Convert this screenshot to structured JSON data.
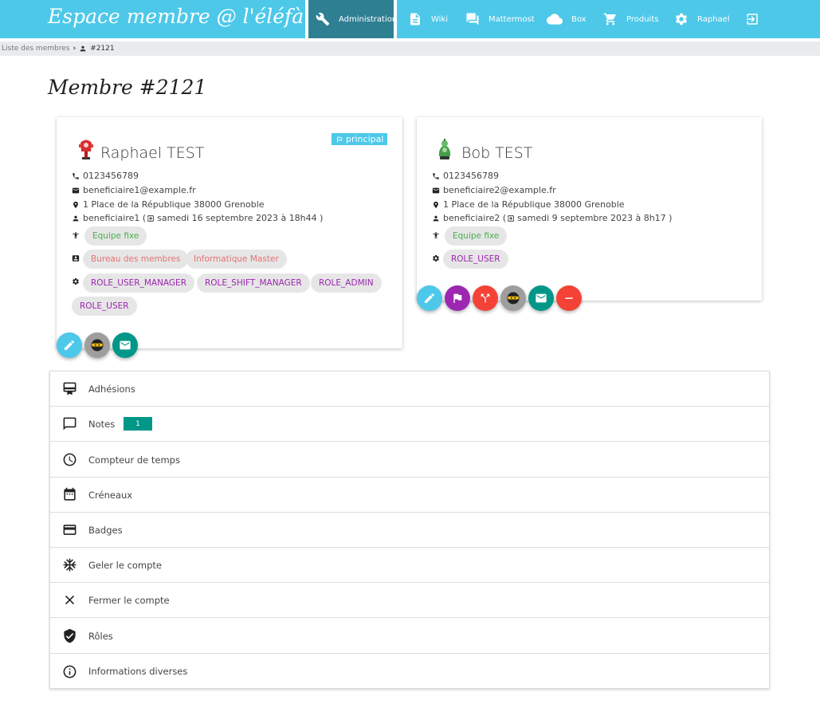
{
  "header": {
    "brand": "Espace membre @ l'éléfàn",
    "nav": [
      {
        "label": "Administration",
        "icon": "wrench-icon"
      },
      {
        "label": "Wiki",
        "icon": "document-icon"
      },
      {
        "label": "Mattermost",
        "icon": "chat-icon"
      },
      {
        "label": "Box",
        "icon": "cloud-icon"
      },
      {
        "label": "Produits",
        "icon": "cart-icon"
      },
      {
        "label": "Raphael",
        "icon": "gear-icon"
      },
      {
        "label": "",
        "icon": "logout-icon"
      }
    ],
    "accent_color": "#4dc8e9",
    "active_color": "#2f7f93"
  },
  "breadcrumb": {
    "parent": "Liste des membres",
    "current": "#2121"
  },
  "page_title": "Membre #2121",
  "beneficiaries": [
    {
      "name": "Raphael TEST",
      "main_badge": "principal",
      "phone": "0123456789",
      "email": "beneficiaire1@example.fr",
      "address": "1 Place de la République 38000 Grenoble",
      "username": "beneficiaire1",
      "last_login": "samedi 16 septembre 2023 à 18h44",
      "team_chips": [
        "Equipe fixe"
      ],
      "commission_chips": [
        "Bureau des membres",
        "Informatique Master"
      ],
      "role_chips": [
        "ROLE_USER_MANAGER",
        "ROLE_SHIFT_MANAGER",
        "ROLE_ADMIN",
        "ROLE_USER"
      ],
      "actions": [
        "edit-icon",
        "ninja-icon",
        "email-icon"
      ]
    },
    {
      "name": "Bob TEST",
      "phone": "0123456789",
      "email": "beneficiaire2@example.fr",
      "address": "1 Place de la République 38000 Grenoble",
      "username": "beneficiaire2",
      "last_login": "samedi 9 septembre 2023 à 8h17",
      "team_chips": [
        "Equipe fixe"
      ],
      "role_chips": [
        "ROLE_USER"
      ],
      "actions": [
        "edit-icon",
        "flag-icon",
        "split-icon",
        "ninja-icon",
        "email-icon",
        "remove-icon"
      ]
    }
  ],
  "sections": [
    {
      "label": "Adhésions",
      "icon": "membership-icon"
    },
    {
      "label": "Notes",
      "icon": "comment-icon",
      "count": "1"
    },
    {
      "label": "Compteur de temps",
      "icon": "clock-icon"
    },
    {
      "label": "Créneaux",
      "icon": "calendar-icon"
    },
    {
      "label": "Badges",
      "icon": "card-icon"
    },
    {
      "label": "Geler le compte",
      "icon": "snowflake-icon"
    },
    {
      "label": "Fermer le compte",
      "icon": "close-icon"
    },
    {
      "label": "Rôles",
      "icon": "shield-icon"
    },
    {
      "label": "Informations diverses",
      "icon": "info-icon"
    }
  ]
}
